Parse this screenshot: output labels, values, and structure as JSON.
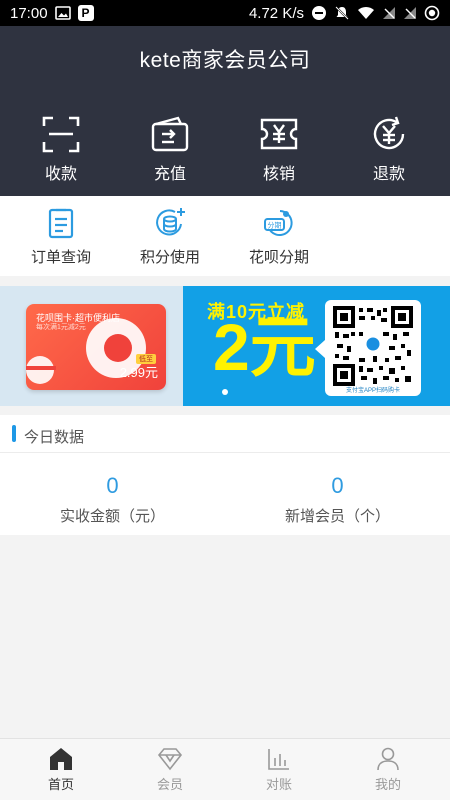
{
  "status_bar": {
    "time": "17:00",
    "net_speed": "4.72 K/s",
    "p_badge": "P"
  },
  "header": {
    "title": "kete商家会员公司"
  },
  "top_actions": [
    {
      "label": "收款",
      "icon": "scan-icon"
    },
    {
      "label": "充值",
      "icon": "wallet-icon"
    },
    {
      "label": "核销",
      "icon": "yen-ticket-icon"
    },
    {
      "label": "退款",
      "icon": "yen-refresh-icon"
    }
  ],
  "quick_actions": [
    {
      "label": "订单查询",
      "icon": "clipboard-icon"
    },
    {
      "label": "积分使用",
      "icon": "points-coins-icon"
    },
    {
      "label": "花呗分期",
      "icon": "installment-icon"
    }
  ],
  "banner": {
    "card_title": "花呗围卡·超市便利店",
    "card_sub": "每次满1元减2元",
    "card_tag": "低至",
    "card_price": "2.99元",
    "promo_line": "满10元立减",
    "promo_big": "2元",
    "qr_caption": "支付宝APP扫码购卡"
  },
  "today": {
    "title": "今日数据",
    "stats": [
      {
        "value": "0",
        "label": "实收金额（元）"
      },
      {
        "value": "0",
        "label": "新增会员（个）"
      }
    ]
  },
  "tabbar": [
    {
      "label": "首页",
      "icon": "home-icon",
      "active": true
    },
    {
      "label": "会员",
      "icon": "diamond-icon",
      "active": false
    },
    {
      "label": "对账",
      "icon": "bar-chart-icon",
      "active": false
    },
    {
      "label": "我的",
      "icon": "user-icon",
      "active": false
    }
  ],
  "colors": {
    "header_bg": "#2f3340",
    "accent_blue": "#1e98e6",
    "promo_yellow": "#fff200",
    "banner_blue": "#12a0e6"
  }
}
